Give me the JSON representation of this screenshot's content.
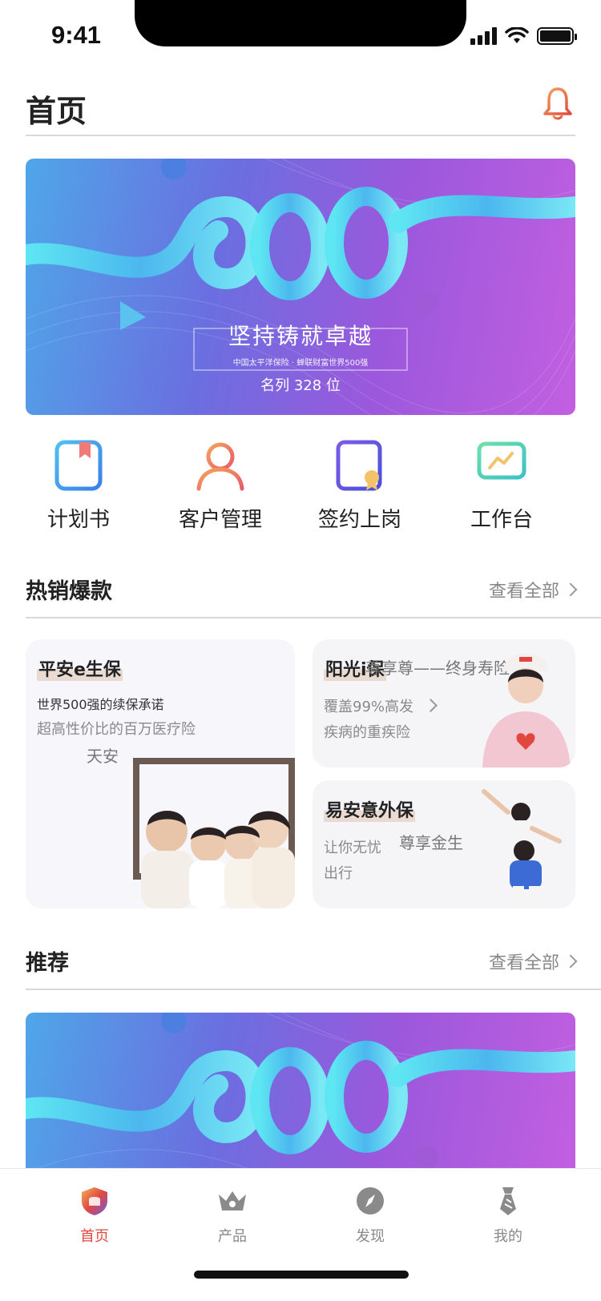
{
  "status_bar": {
    "time": "9:41"
  },
  "header": {
    "title": "首页"
  },
  "banner": {
    "headline": "坚持铸就卓越",
    "subline": "中国太平洋保险 · 蝉联财富世界500强",
    "rank_text": "名列 328 位",
    "hero_number": "500"
  },
  "quick_actions": [
    {
      "label": "计划书",
      "icon": "plan-book-icon"
    },
    {
      "label": "客户管理",
      "icon": "customer-icon"
    },
    {
      "label": "签约上岗",
      "icon": "contract-icon"
    },
    {
      "label": "工作台",
      "icon": "workbench-icon"
    }
  ],
  "hot_section": {
    "title": "热销爆款",
    "more": "查看全部"
  },
  "hot_cards": {
    "big": {
      "title": "平安e生保",
      "line1": "世界500强的续保承诺",
      "line2": "超高性价比的百万医疗险",
      "ghost": "天安"
    },
    "top": {
      "title": "阳光i保",
      "ghost": "尊享尊——终身寿险",
      "line1": "覆盖99%高发",
      "line2": "疾病的重疾险"
    },
    "bottom": {
      "title": "易安意外保",
      "line1": "让你无忧",
      "ghost": "尊享金生",
      "line2": "出行"
    }
  },
  "recommend_section": {
    "title": "推荐",
    "more": "查看全部"
  },
  "tabs": [
    {
      "label": "首页",
      "icon": "home-shield-icon",
      "active": true
    },
    {
      "label": "产品",
      "icon": "crown-icon",
      "active": false
    },
    {
      "label": "发现",
      "icon": "compass-icon",
      "active": false
    },
    {
      "label": "我的",
      "icon": "tie-icon",
      "active": false
    }
  ],
  "colors": {
    "accent": "#e0483f",
    "banner_start": "#4fa6e8",
    "banner_end": "#c25fe0"
  }
}
